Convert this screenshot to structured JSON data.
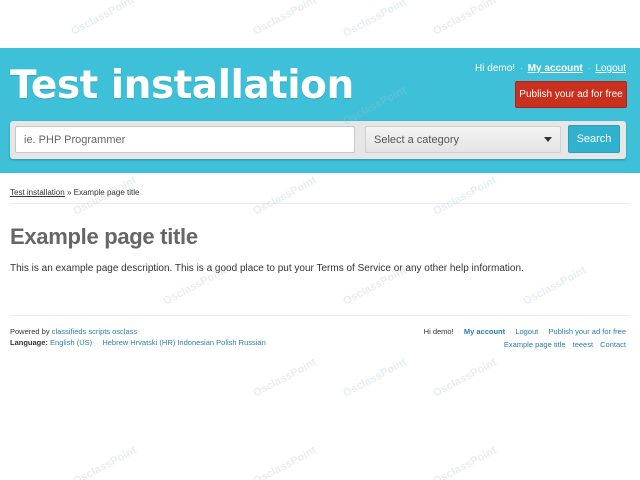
{
  "header": {
    "site_title": "Test installation",
    "user_nav": {
      "greeting": "Hi demo!",
      "my_account": "My account",
      "logout": "Logout",
      "separator": "·"
    },
    "publish_label": "Publish your ad for free"
  },
  "search": {
    "placeholder": "ie. PHP Programmer",
    "category_label": "Select a category",
    "button_label": "Search"
  },
  "breadcrumb": {
    "home": "Test installation",
    "separator": "»",
    "current": "Example page title"
  },
  "page": {
    "title": "Example page title",
    "description": "This is an example page description. This is a good place to put your Terms of Service or any other help information."
  },
  "footer": {
    "powered_prefix": "Powered by",
    "powered_link": "classifieds scripts osclass",
    "language_label": "Language:",
    "languages": [
      "English (US)",
      "Hebrew",
      "Hrvatski (HR)",
      "Indonesian",
      "Polish",
      "Russian"
    ],
    "separator": "·",
    "right_line1": {
      "greeting": "Hi demo!",
      "my_account": "My account",
      "logout": "Logout",
      "publish": "Publish your ad for free"
    },
    "right_line2": [
      "Example page title",
      "teeest",
      "Contact"
    ]
  },
  "watermark": "OsclassPoint",
  "colors": {
    "header_bg": "#3ec0d8",
    "publish_bg": "#c9301e",
    "search_btn_bg": "#30b2cf",
    "link": "#2a7fa8"
  }
}
